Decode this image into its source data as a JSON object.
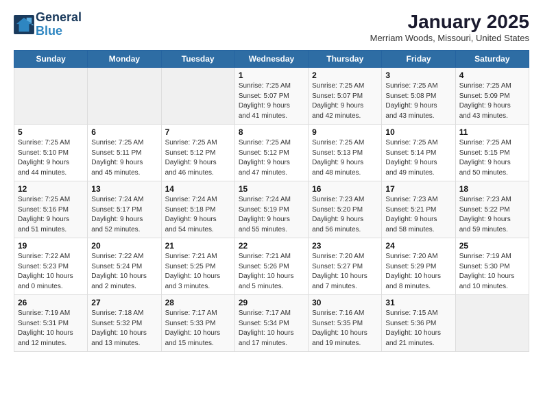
{
  "header": {
    "logo_line1": "General",
    "logo_line2": "Blue",
    "title": "January 2025",
    "subtitle": "Merriam Woods, Missouri, United States"
  },
  "weekdays": [
    "Sunday",
    "Monday",
    "Tuesday",
    "Wednesday",
    "Thursday",
    "Friday",
    "Saturday"
  ],
  "weeks": [
    [
      {
        "day": "",
        "info": ""
      },
      {
        "day": "",
        "info": ""
      },
      {
        "day": "",
        "info": ""
      },
      {
        "day": "1",
        "info": "Sunrise: 7:25 AM\nSunset: 5:07 PM\nDaylight: 9 hours\nand 41 minutes."
      },
      {
        "day": "2",
        "info": "Sunrise: 7:25 AM\nSunset: 5:07 PM\nDaylight: 9 hours\nand 42 minutes."
      },
      {
        "day": "3",
        "info": "Sunrise: 7:25 AM\nSunset: 5:08 PM\nDaylight: 9 hours\nand 43 minutes."
      },
      {
        "day": "4",
        "info": "Sunrise: 7:25 AM\nSunset: 5:09 PM\nDaylight: 9 hours\nand 43 minutes."
      }
    ],
    [
      {
        "day": "5",
        "info": "Sunrise: 7:25 AM\nSunset: 5:10 PM\nDaylight: 9 hours\nand 44 minutes."
      },
      {
        "day": "6",
        "info": "Sunrise: 7:25 AM\nSunset: 5:11 PM\nDaylight: 9 hours\nand 45 minutes."
      },
      {
        "day": "7",
        "info": "Sunrise: 7:25 AM\nSunset: 5:12 PM\nDaylight: 9 hours\nand 46 minutes."
      },
      {
        "day": "8",
        "info": "Sunrise: 7:25 AM\nSunset: 5:12 PM\nDaylight: 9 hours\nand 47 minutes."
      },
      {
        "day": "9",
        "info": "Sunrise: 7:25 AM\nSunset: 5:13 PM\nDaylight: 9 hours\nand 48 minutes."
      },
      {
        "day": "10",
        "info": "Sunrise: 7:25 AM\nSunset: 5:14 PM\nDaylight: 9 hours\nand 49 minutes."
      },
      {
        "day": "11",
        "info": "Sunrise: 7:25 AM\nSunset: 5:15 PM\nDaylight: 9 hours\nand 50 minutes."
      }
    ],
    [
      {
        "day": "12",
        "info": "Sunrise: 7:25 AM\nSunset: 5:16 PM\nDaylight: 9 hours\nand 51 minutes."
      },
      {
        "day": "13",
        "info": "Sunrise: 7:24 AM\nSunset: 5:17 PM\nDaylight: 9 hours\nand 52 minutes."
      },
      {
        "day": "14",
        "info": "Sunrise: 7:24 AM\nSunset: 5:18 PM\nDaylight: 9 hours\nand 54 minutes."
      },
      {
        "day": "15",
        "info": "Sunrise: 7:24 AM\nSunset: 5:19 PM\nDaylight: 9 hours\nand 55 minutes."
      },
      {
        "day": "16",
        "info": "Sunrise: 7:23 AM\nSunset: 5:20 PM\nDaylight: 9 hours\nand 56 minutes."
      },
      {
        "day": "17",
        "info": "Sunrise: 7:23 AM\nSunset: 5:21 PM\nDaylight: 9 hours\nand 58 minutes."
      },
      {
        "day": "18",
        "info": "Sunrise: 7:23 AM\nSunset: 5:22 PM\nDaylight: 9 hours\nand 59 minutes."
      }
    ],
    [
      {
        "day": "19",
        "info": "Sunrise: 7:22 AM\nSunset: 5:23 PM\nDaylight: 10 hours\nand 0 minutes."
      },
      {
        "day": "20",
        "info": "Sunrise: 7:22 AM\nSunset: 5:24 PM\nDaylight: 10 hours\nand 2 minutes."
      },
      {
        "day": "21",
        "info": "Sunrise: 7:21 AM\nSunset: 5:25 PM\nDaylight: 10 hours\nand 3 minutes."
      },
      {
        "day": "22",
        "info": "Sunrise: 7:21 AM\nSunset: 5:26 PM\nDaylight: 10 hours\nand 5 minutes."
      },
      {
        "day": "23",
        "info": "Sunrise: 7:20 AM\nSunset: 5:27 PM\nDaylight: 10 hours\nand 7 minutes."
      },
      {
        "day": "24",
        "info": "Sunrise: 7:20 AM\nSunset: 5:29 PM\nDaylight: 10 hours\nand 8 minutes."
      },
      {
        "day": "25",
        "info": "Sunrise: 7:19 AM\nSunset: 5:30 PM\nDaylight: 10 hours\nand 10 minutes."
      }
    ],
    [
      {
        "day": "26",
        "info": "Sunrise: 7:19 AM\nSunset: 5:31 PM\nDaylight: 10 hours\nand 12 minutes."
      },
      {
        "day": "27",
        "info": "Sunrise: 7:18 AM\nSunset: 5:32 PM\nDaylight: 10 hours\nand 13 minutes."
      },
      {
        "day": "28",
        "info": "Sunrise: 7:17 AM\nSunset: 5:33 PM\nDaylight: 10 hours\nand 15 minutes."
      },
      {
        "day": "29",
        "info": "Sunrise: 7:17 AM\nSunset: 5:34 PM\nDaylight: 10 hours\nand 17 minutes."
      },
      {
        "day": "30",
        "info": "Sunrise: 7:16 AM\nSunset: 5:35 PM\nDaylight: 10 hours\nand 19 minutes."
      },
      {
        "day": "31",
        "info": "Sunrise: 7:15 AM\nSunset: 5:36 PM\nDaylight: 10 hours\nand 21 minutes."
      },
      {
        "day": "",
        "info": ""
      }
    ]
  ]
}
